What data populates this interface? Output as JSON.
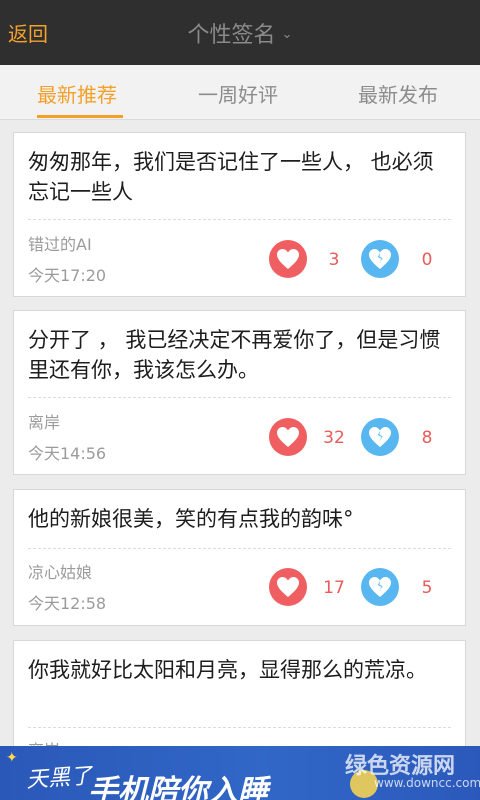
{
  "header": {
    "back_label": "返回",
    "title": "个性签名"
  },
  "tabs": [
    {
      "label": "最新推荐",
      "active": true
    },
    {
      "label": "一周好评",
      "active": false
    },
    {
      "label": "最新发布",
      "active": false
    }
  ],
  "posts": [
    {
      "text": "匆匆那年，我们是否记住了一些人，  也必须忘记一些人",
      "author": "错过的AI",
      "time": "今天17:20",
      "likes": "3",
      "dislikes": "0"
    },
    {
      "text": "分开了 ，  我已经决定不再爱你了，但是习惯里还有你，我该怎么办。",
      "author": "离岸",
      "time": "今天14:56",
      "likes": "32",
      "dislikes": "8"
    },
    {
      "text": "他的新娘很美，笑的有点我的韵味°",
      "author": "凉心姑娘",
      "time": "今天12:58",
      "likes": "17",
      "dislikes": "5"
    },
    {
      "text": "你我就好比太阳和月亮，显得那么的荒凉。",
      "author": "离岸",
      "time": "",
      "likes": "",
      "dislikes": ""
    }
  ],
  "banner": {
    "line1": "天黑了",
    "line2": "手机陪你入睡",
    "watermark": "绿色资源网",
    "watermark_url": "www.downcc.com"
  },
  "colors": {
    "accent": "#f3a12b",
    "like": "#ef5f61",
    "dislike": "#58b7f0",
    "count": "#ea5a58"
  }
}
